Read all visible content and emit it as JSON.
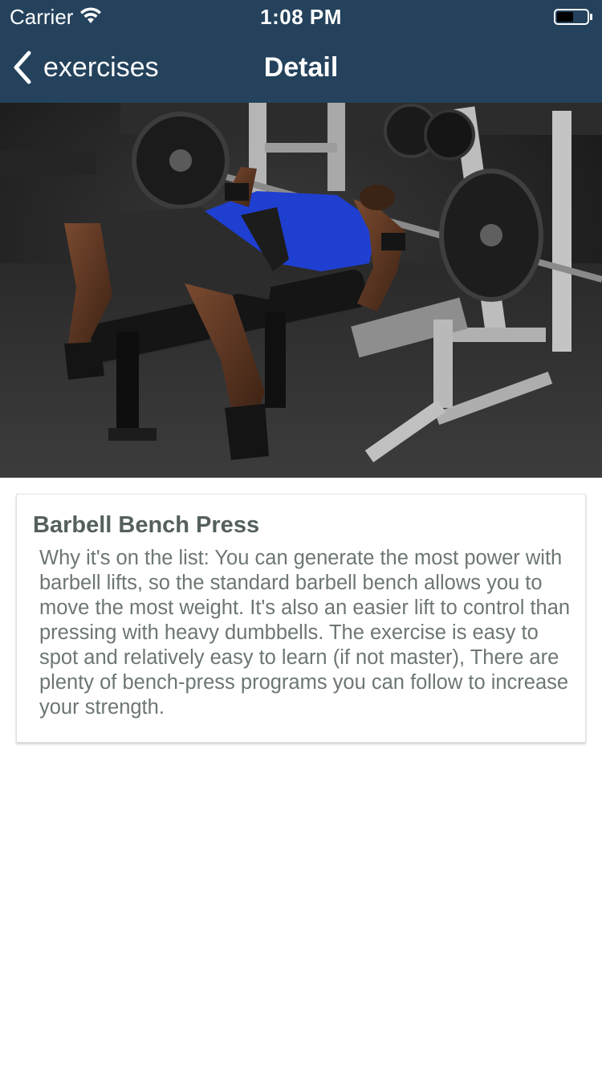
{
  "status_bar": {
    "carrier": "Carrier",
    "time": "1:08 PM",
    "wifi_icon": "wifi-icon",
    "battery_icon": "battery-icon"
  },
  "nav": {
    "back_label": "exercises",
    "back_icon": "chevron-left-icon",
    "title": "Detail"
  },
  "hero_image": {
    "subject": "man performing barbell bench press in a gym"
  },
  "exercise": {
    "name": "Barbell Bench Press",
    "description": "Why it's on the list: You can generate the most power with barbell lifts, so the standard barbell bench allows you to move the most weight. It's also an easier lift to control than pressing with heavy dumbbells. The exercise is easy to spot and relatively easy to learn (if not master), There are plenty of bench-press programs you can follow to increase your strength."
  },
  "colors": {
    "nav_background": "#24425c",
    "title_text": "#55605e",
    "body_text": "#6c7675"
  }
}
